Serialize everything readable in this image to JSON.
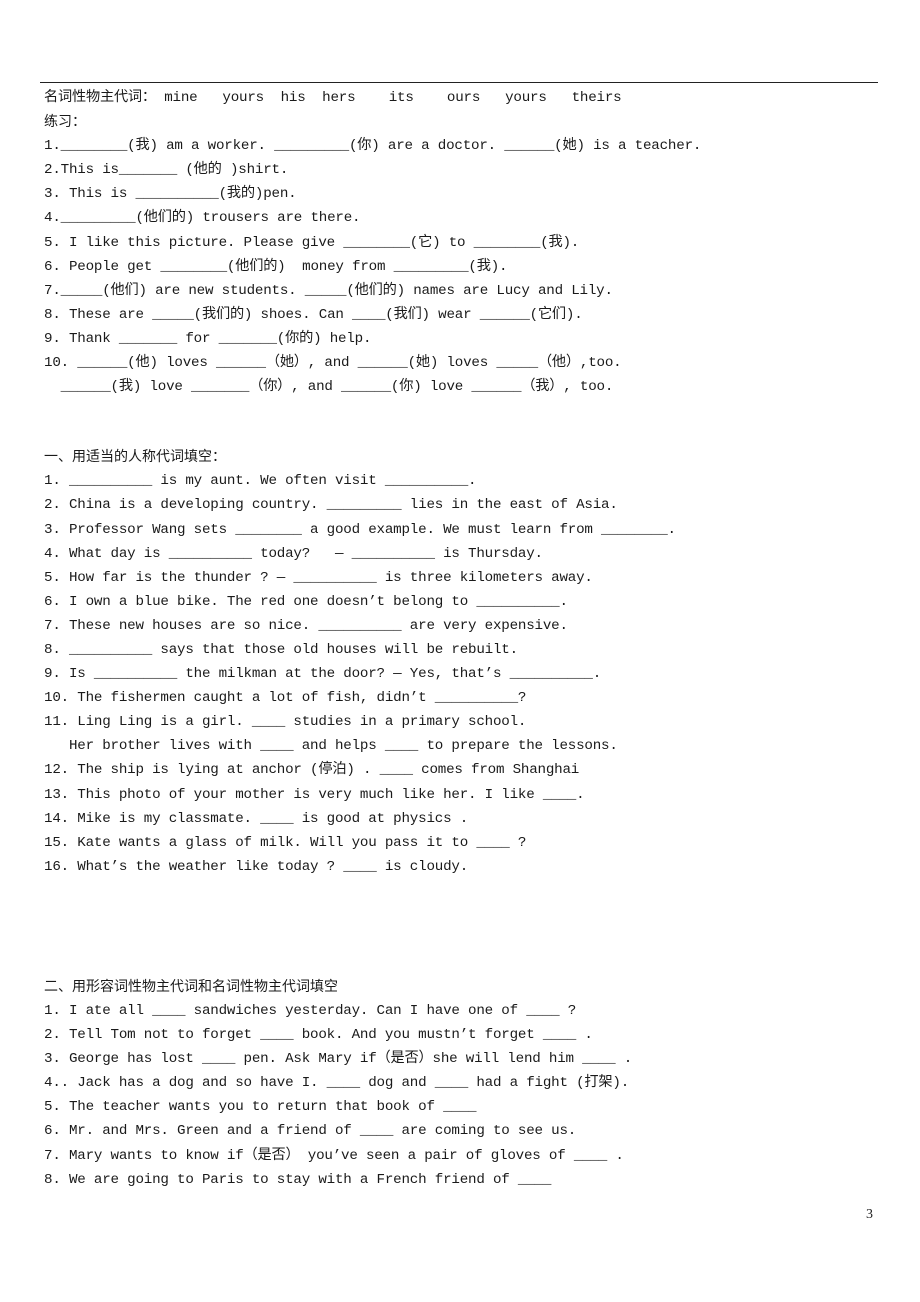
{
  "header": {
    "possessive_line": "名词性物主代词： mine   yours  his  hers    its    ours   yours   theirs",
    "practice_label": "练习："
  },
  "practice": {
    "items": [
      "1.________(我) am a worker. _________(你) are a doctor. ______(她) is a teacher.",
      "2.This is_______ (他的 )shirt.",
      "3. This is __________(我的)pen.",
      "4._________(他们的) trousers are there.",
      "5. I like this picture. Please give ________(它) to ________(我).",
      "6. People get ________(他们的)  money from _________(我).",
      "7._____(他们) are new students. _____(他们的) names are Lucy and Lily.",
      "8. These are _____(我们的) shoes. Can ____(我们) wear ______(它们).",
      "9. Thank _______ for _______(你的) help.",
      "10. ______(他) loves ______（她）, and ______(她) loves _____（他）,too.",
      "  ______(我) love _______（你）, and ______(你) love ______（我）, too."
    ]
  },
  "section1": {
    "title": "一、用适当的人称代词填空：",
    "items": [
      "1. __________ is my aunt. We often visit __________.",
      "2. China is a developing country. _________ lies in the east of Asia.",
      "3. Professor Wang sets ________ a good example. We must learn from ________.",
      "4. What day is __________ today?   — __________ is Thursday.",
      "5. How far is the thunder ? — __________ is three kilometers away.",
      "6. I own a blue bike. The red one doesn’t belong to __________.",
      "7. These new houses are so nice. __________ are very expensive.",
      "8. __________ says that those old houses will be rebuilt.",
      "9. Is __________ the milkman at the door? — Yes, that’s __________.",
      "10. The fishermen caught a lot of fish, didn’t __________?",
      "11. Ling Ling is a girl. ____ studies in a primary school.",
      "   Her brother lives with ____ and helps ____ to prepare the lessons.",
      "12. The ship is lying at anchor (停泊) . ____ comes from Shanghai",
      "13. This photo of your mother is very much like her. I like ____.",
      "14. Mike is my classmate. ____ is good at physics .",
      "15. Kate wants a glass of milk. Will you pass it to ____ ?",
      "16. What’s the weather like today ? ____ is cloudy."
    ]
  },
  "section2": {
    "title": "二、用形容词性物主代词和名词性物主代词填空",
    "items": [
      "1. I ate all ____ sandwiches yesterday. Can I have one of ____ ?",
      "2. Tell Tom not to forget ____ book. And you mustn’t forget ____ .",
      "3. George has lost ____ pen. Ask Mary if（是否）she will lend him ____ .",
      "4.. Jack has a dog and so have I. ____ dog and ____ had a fight (打架).",
      "5. The teacher wants you to return that book of ____",
      "6. Mr. and Mrs. Green and a friend of ____ are coming to see us.",
      "7. Mary wants to know if（是否） you’ve seen a pair of gloves of ____ .",
      "8. We are going to Paris to stay with a French friend of ____"
    ]
  },
  "footer": {
    "page_number": "3"
  }
}
